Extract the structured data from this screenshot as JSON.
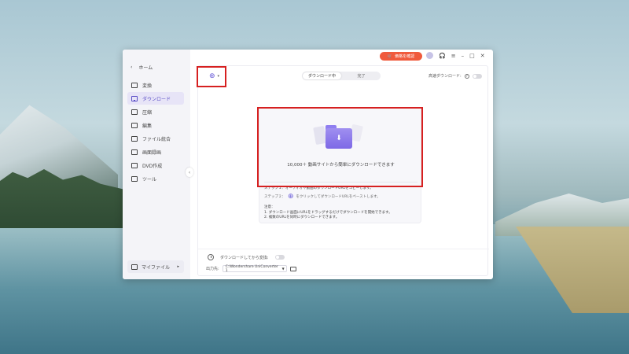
{
  "sidebar": {
    "home": "ホーム",
    "items": [
      {
        "label": "変換",
        "active": false
      },
      {
        "label": "ダウンロード",
        "active": true
      },
      {
        "label": "圧縮",
        "active": false
      },
      {
        "label": "編集",
        "active": false
      },
      {
        "label": "ファイル統合",
        "active": false
      },
      {
        "label": "画面録画",
        "active": false
      },
      {
        "label": "DVD作成",
        "active": false
      },
      {
        "label": "ツール",
        "active": false
      }
    ],
    "my_files": "マイファイル"
  },
  "titlebar": {
    "promo": "価格を確認"
  },
  "main": {
    "tabs": [
      {
        "label": "ダウンロード中",
        "active": true
      },
      {
        "label": "完了",
        "active": false
      }
    ],
    "high_speed_label": "高速ダウンロード:",
    "high_speed_on": false,
    "drop_text": "10,000＋ 動画サイトから簡単にダウンロードできます",
    "step1": "ステップ１：オーディオや動画のダウンロードURLをコピーします。",
    "step2_prefix": "ステップ２：",
    "step2_suffix": "をクリックしてダウンロードURLをペーストします。",
    "notes_title": "注意：",
    "note1": "1. ダウンロード画面にURLをドラッグするだけでダウンロードを開始できます。",
    "note2": "2. 複数のURLを同時にダウンロードできます。"
  },
  "bottom": {
    "convert_after_label": "ダウンロードしてから変換:",
    "convert_after_on": false,
    "output_label": "出力先:",
    "output_path": "C:\\Wondershare UniConverter 1"
  },
  "colors": {
    "accent": "#6a5cd8",
    "promo": "#f05a3c",
    "highlight": "#d62020"
  }
}
